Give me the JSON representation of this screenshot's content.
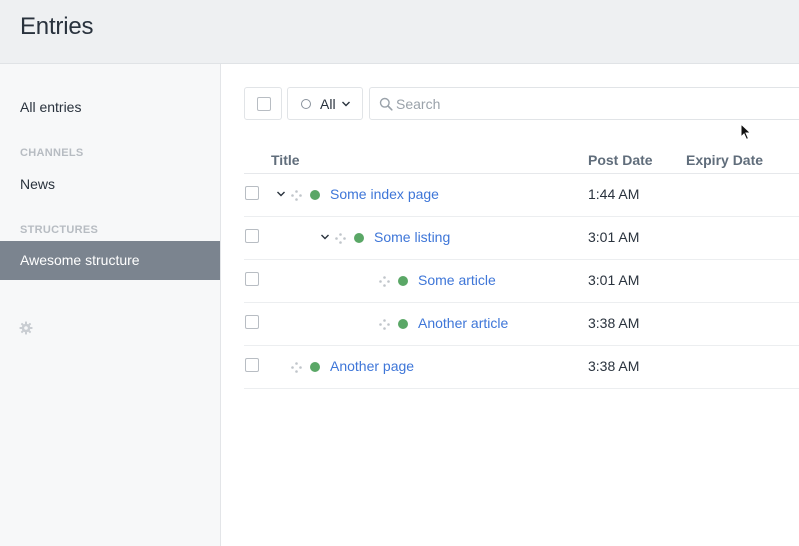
{
  "header": {
    "title": "Entries"
  },
  "sidebar": {
    "all_entries": "All entries",
    "channels_heading": "CHANNELS",
    "news": "News",
    "structures_heading": "STRUCTURES",
    "awesome_structure": "Awesome structure",
    "settings_icon": "gear-icon"
  },
  "toolbar": {
    "status_label": "All",
    "search_placeholder": "Search"
  },
  "table": {
    "headers": {
      "title": "Title",
      "post_date": "Post Date",
      "expiry_date": "Expiry Date"
    },
    "rows": [
      {
        "title": "Some index page",
        "post_date": "1:44 AM",
        "status_color": "#5aa766"
      },
      {
        "title": "Some listing",
        "post_date": "3:01 AM",
        "status_color": "#5aa766"
      },
      {
        "title": "Some article",
        "post_date": "3:01 AM",
        "status_color": "#5aa766"
      },
      {
        "title": "Another article",
        "post_date": "3:38 AM",
        "status_color": "#5aa766"
      },
      {
        "title": "Another page",
        "post_date": "3:38 AM",
        "status_color": "#5aa766"
      }
    ]
  },
  "colors": {
    "accent": "#3e76d8",
    "active_sidebar": "#7b848f",
    "live_status": "#5aa766"
  }
}
